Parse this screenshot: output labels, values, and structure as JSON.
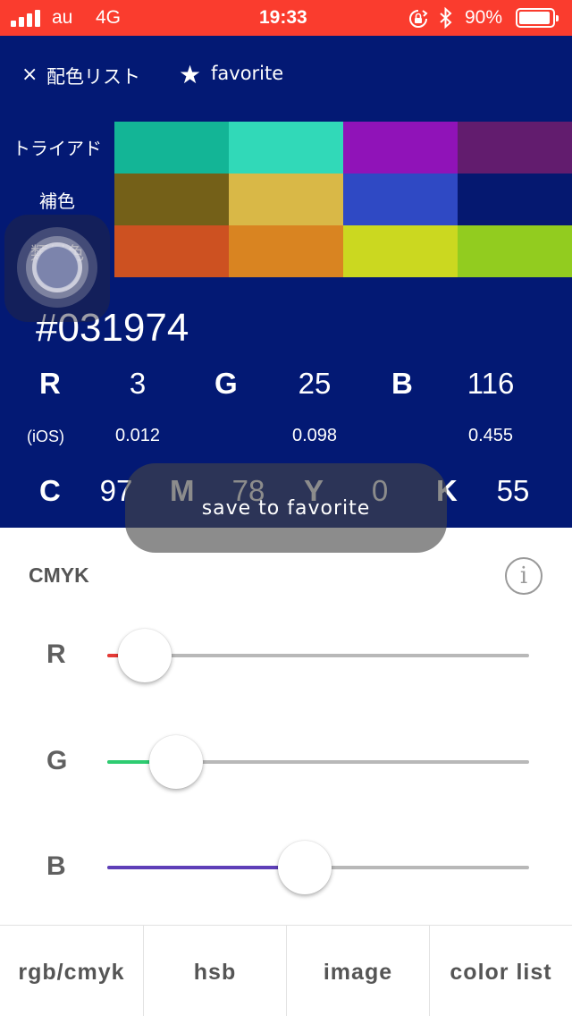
{
  "status_bar": {
    "carrier": "au",
    "network": "4G",
    "time": "19:33",
    "battery": "90%",
    "battery_level": 0.9,
    "icons": [
      "signal-bars-icon",
      "orientation-lock-icon",
      "bluetooth-icon",
      "battery-icon"
    ]
  },
  "nav": {
    "close_icon": "×",
    "list_label": "配色リスト",
    "star_icon": "★",
    "favorite_label": "favorite"
  },
  "schemes": [
    {
      "label": "トライアド",
      "colors": [
        "#13b596",
        "#31d9b8",
        "#9013b8",
        "#621c6e"
      ]
    },
    {
      "label": "補色",
      "colors": [
        "#746018",
        "#d9b847",
        "#2f49c4",
        "#051870"
      ]
    },
    {
      "label": "類似色",
      "colors": [
        "#cd5121",
        "#d98421",
        "#cbd820",
        "#92cc1f"
      ]
    }
  ],
  "color": {
    "base": "#031974",
    "hex": "#031974",
    "rgb": {
      "r_label": "R",
      "r": "3",
      "g_label": "G",
      "g": "25",
      "b_label": "B",
      "b": "116"
    },
    "ios_label": "(iOS)",
    "ios": {
      "r": "0.012",
      "g": "0.098",
      "b": "0.455"
    },
    "cmyk": {
      "c_label": "C",
      "c": "97",
      "m_label": "M",
      "m": "78",
      "y_label": "Y",
      "y": "0",
      "k_label": "K",
      "k": "55"
    }
  },
  "toast": {
    "text": "save  to  favorite"
  },
  "section": {
    "title": "CMYK",
    "info_icon": "i"
  },
  "sliders": [
    {
      "label": "R",
      "value": 3,
      "max": 255,
      "color": "#e53935"
    },
    {
      "label": "G",
      "value": 25,
      "max": 255,
      "color": "#2ecc71"
    },
    {
      "label": "B",
      "value": 116,
      "max": 255,
      "color": "#5e3fb8"
    }
  ],
  "tabs": [
    "rgb/cmyk",
    "hsb",
    "image",
    "color  list"
  ]
}
